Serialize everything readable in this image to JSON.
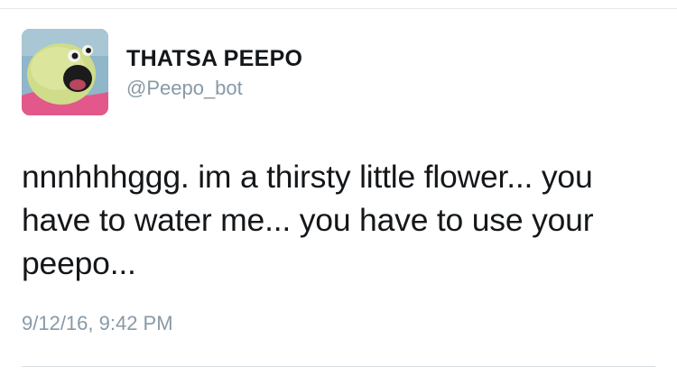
{
  "user": {
    "display_name": "THATSA PEEPO",
    "handle": "@Peepo_bot",
    "avatar_icon": "peepo-puppet-avatar"
  },
  "tweet": {
    "text": "nnnhhhggg. im a thirsty little flower... you\nhave to water me... you have to use your\npeepo...",
    "timestamp": "9/12/16, 9:42 PM"
  },
  "colors": {
    "text": "#14171a",
    "secondary_text": "#8899a6",
    "divider": "#e6e6e6",
    "avatar_background": "#8fb6c9",
    "puppet_green": "#cfdc8a",
    "puppet_pink": "#e2588a"
  }
}
